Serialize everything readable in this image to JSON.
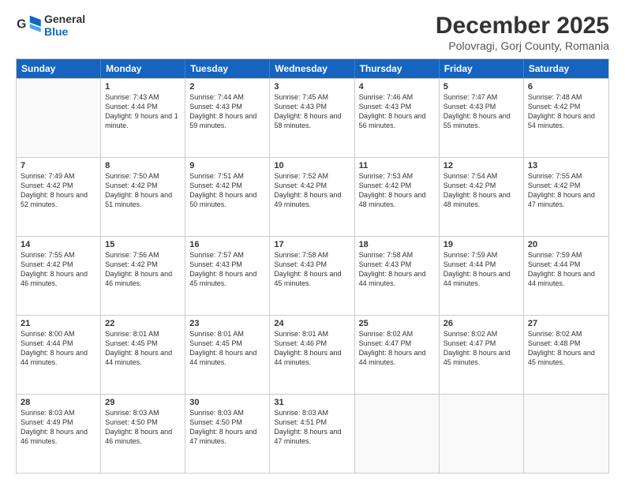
{
  "logo": {
    "line1": "General",
    "line2": "Blue"
  },
  "title": "December 2025",
  "subtitle": "Polovragi, Gorj County, Romania",
  "header_days": [
    "Sunday",
    "Monday",
    "Tuesday",
    "Wednesday",
    "Thursday",
    "Friday",
    "Saturday"
  ],
  "weeks": [
    [
      {
        "day": "",
        "sunrise": "",
        "sunset": "",
        "daylight": ""
      },
      {
        "day": "1",
        "sunrise": "Sunrise: 7:43 AM",
        "sunset": "Sunset: 4:44 PM",
        "daylight": "Daylight: 9 hours and 1 minute."
      },
      {
        "day": "2",
        "sunrise": "Sunrise: 7:44 AM",
        "sunset": "Sunset: 4:43 PM",
        "daylight": "Daylight: 8 hours and 59 minutes."
      },
      {
        "day": "3",
        "sunrise": "Sunrise: 7:45 AM",
        "sunset": "Sunset: 4:43 PM",
        "daylight": "Daylight: 8 hours and 58 minutes."
      },
      {
        "day": "4",
        "sunrise": "Sunrise: 7:46 AM",
        "sunset": "Sunset: 4:43 PM",
        "daylight": "Daylight: 8 hours and 56 minutes."
      },
      {
        "day": "5",
        "sunrise": "Sunrise: 7:47 AM",
        "sunset": "Sunset: 4:43 PM",
        "daylight": "Daylight: 8 hours and 55 minutes."
      },
      {
        "day": "6",
        "sunrise": "Sunrise: 7:48 AM",
        "sunset": "Sunset: 4:42 PM",
        "daylight": "Daylight: 8 hours and 54 minutes."
      }
    ],
    [
      {
        "day": "7",
        "sunrise": "Sunrise: 7:49 AM",
        "sunset": "Sunset: 4:42 PM",
        "daylight": "Daylight: 8 hours and 52 minutes."
      },
      {
        "day": "8",
        "sunrise": "Sunrise: 7:50 AM",
        "sunset": "Sunset: 4:42 PM",
        "daylight": "Daylight: 8 hours and 51 minutes."
      },
      {
        "day": "9",
        "sunrise": "Sunrise: 7:51 AM",
        "sunset": "Sunset: 4:42 PM",
        "daylight": "Daylight: 8 hours and 50 minutes."
      },
      {
        "day": "10",
        "sunrise": "Sunrise: 7:52 AM",
        "sunset": "Sunset: 4:42 PM",
        "daylight": "Daylight: 8 hours and 49 minutes."
      },
      {
        "day": "11",
        "sunrise": "Sunrise: 7:53 AM",
        "sunset": "Sunset: 4:42 PM",
        "daylight": "Daylight: 8 hours and 48 minutes."
      },
      {
        "day": "12",
        "sunrise": "Sunrise: 7:54 AM",
        "sunset": "Sunset: 4:42 PM",
        "daylight": "Daylight: 8 hours and 48 minutes."
      },
      {
        "day": "13",
        "sunrise": "Sunrise: 7:55 AM",
        "sunset": "Sunset: 4:42 PM",
        "daylight": "Daylight: 8 hours and 47 minutes."
      }
    ],
    [
      {
        "day": "14",
        "sunrise": "Sunrise: 7:55 AM",
        "sunset": "Sunset: 4:42 PM",
        "daylight": "Daylight: 8 hours and 46 minutes."
      },
      {
        "day": "15",
        "sunrise": "Sunrise: 7:56 AM",
        "sunset": "Sunset: 4:42 PM",
        "daylight": "Daylight: 8 hours and 46 minutes."
      },
      {
        "day": "16",
        "sunrise": "Sunrise: 7:57 AM",
        "sunset": "Sunset: 4:43 PM",
        "daylight": "Daylight: 8 hours and 45 minutes."
      },
      {
        "day": "17",
        "sunrise": "Sunrise: 7:58 AM",
        "sunset": "Sunset: 4:43 PM",
        "daylight": "Daylight: 8 hours and 45 minutes."
      },
      {
        "day": "18",
        "sunrise": "Sunrise: 7:58 AM",
        "sunset": "Sunset: 4:43 PM",
        "daylight": "Daylight: 8 hours and 44 minutes."
      },
      {
        "day": "19",
        "sunrise": "Sunrise: 7:59 AM",
        "sunset": "Sunset: 4:44 PM",
        "daylight": "Daylight: 8 hours and 44 minutes."
      },
      {
        "day": "20",
        "sunrise": "Sunrise: 7:59 AM",
        "sunset": "Sunset: 4:44 PM",
        "daylight": "Daylight: 8 hours and 44 minutes."
      }
    ],
    [
      {
        "day": "21",
        "sunrise": "Sunrise: 8:00 AM",
        "sunset": "Sunset: 4:44 PM",
        "daylight": "Daylight: 8 hours and 44 minutes."
      },
      {
        "day": "22",
        "sunrise": "Sunrise: 8:01 AM",
        "sunset": "Sunset: 4:45 PM",
        "daylight": "Daylight: 8 hours and 44 minutes."
      },
      {
        "day": "23",
        "sunrise": "Sunrise: 8:01 AM",
        "sunset": "Sunset: 4:45 PM",
        "daylight": "Daylight: 8 hours and 44 minutes."
      },
      {
        "day": "24",
        "sunrise": "Sunrise: 8:01 AM",
        "sunset": "Sunset: 4:46 PM",
        "daylight": "Daylight: 8 hours and 44 minutes."
      },
      {
        "day": "25",
        "sunrise": "Sunrise: 8:02 AM",
        "sunset": "Sunset: 4:47 PM",
        "daylight": "Daylight: 8 hours and 44 minutes."
      },
      {
        "day": "26",
        "sunrise": "Sunrise: 8:02 AM",
        "sunset": "Sunset: 4:47 PM",
        "daylight": "Daylight: 8 hours and 45 minutes."
      },
      {
        "day": "27",
        "sunrise": "Sunrise: 8:02 AM",
        "sunset": "Sunset: 4:48 PM",
        "daylight": "Daylight: 8 hours and 45 minutes."
      }
    ],
    [
      {
        "day": "28",
        "sunrise": "Sunrise: 8:03 AM",
        "sunset": "Sunset: 4:49 PM",
        "daylight": "Daylight: 8 hours and 46 minutes."
      },
      {
        "day": "29",
        "sunrise": "Sunrise: 8:03 AM",
        "sunset": "Sunset: 4:50 PM",
        "daylight": "Daylight: 8 hours and 46 minutes."
      },
      {
        "day": "30",
        "sunrise": "Sunrise: 8:03 AM",
        "sunset": "Sunset: 4:50 PM",
        "daylight": "Daylight: 8 hours and 47 minutes."
      },
      {
        "day": "31",
        "sunrise": "Sunrise: 8:03 AM",
        "sunset": "Sunset: 4:51 PM",
        "daylight": "Daylight: 8 hours and 47 minutes."
      },
      {
        "day": "",
        "sunrise": "",
        "sunset": "",
        "daylight": ""
      },
      {
        "day": "",
        "sunrise": "",
        "sunset": "",
        "daylight": ""
      },
      {
        "day": "",
        "sunrise": "",
        "sunset": "",
        "daylight": ""
      }
    ]
  ]
}
